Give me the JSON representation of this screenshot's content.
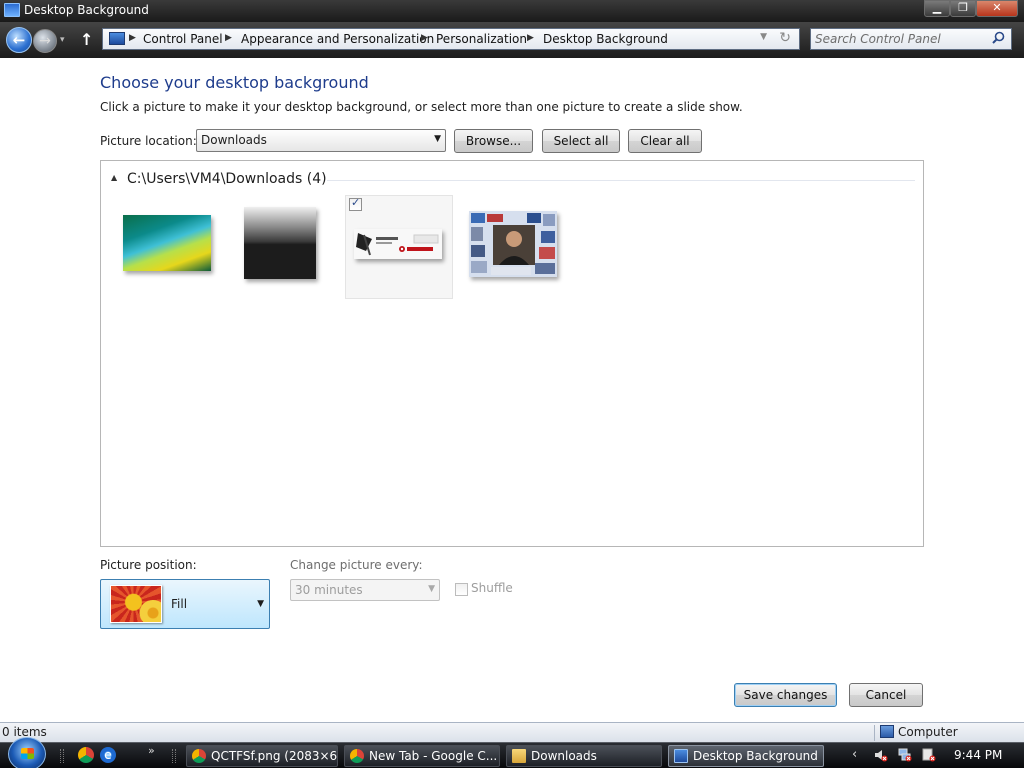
{
  "window": {
    "title": "Desktop Background"
  },
  "window_buttons": {
    "minimize": "▁",
    "maximize": "❐",
    "close": "✕"
  },
  "nav": {
    "back_glyph": "←",
    "forward_glyph": "→",
    "history_glyph": "▾",
    "up_glyph": "↑"
  },
  "breadcrumb": [
    "Control Panel",
    "Appearance and Personalization",
    "Personalization",
    "Desktop Background"
  ],
  "breadcrumb_separator": "▶",
  "search": {
    "placeholder": "Search Control Panel"
  },
  "page": {
    "heading": "Choose your desktop background",
    "instruction": "Click a picture to make it your desktop background, or select more than one picture to create a slide show."
  },
  "picture_location": {
    "label": "Picture location:",
    "value": "Downloads",
    "browse": "Browse...",
    "select_all": "Select all",
    "clear_all": "Clear all"
  },
  "picture_group": {
    "title": "C:\\Users\\VM4\\Downloads (4)",
    "toggle_glyph": "▲",
    "thumbnails": [
      {
        "name": "vista-aurora",
        "selected": false
      },
      {
        "name": "gray-gradient",
        "selected": false
      },
      {
        "name": "target-logo",
        "selected": true
      },
      {
        "name": "photo-collage",
        "selected": false
      }
    ]
  },
  "picture_position": {
    "label": "Picture position:",
    "value": "Fill"
  },
  "change_picture": {
    "label": "Change picture every:",
    "value": "30 minutes",
    "shuffle_label": "Shuffle",
    "enabled": false
  },
  "actions": {
    "save": "Save changes",
    "cancel": "Cancel"
  },
  "status": {
    "items": "0 items",
    "location": "Computer"
  },
  "taskbar": {
    "tasks": [
      {
        "label": "QCTFSf.png (2083×6...",
        "icon": "chrome-icon"
      },
      {
        "label": "New Tab - Google C...",
        "icon": "chrome-icon"
      },
      {
        "label": "Downloads",
        "icon": "folder-icon"
      },
      {
        "label": "Desktop Background",
        "icon": "control-panel-icon",
        "active": true
      }
    ],
    "quick_launch_more": "»",
    "tray_arrow": "‹",
    "clock": "9:44 PM"
  },
  "colors": {
    "heading": "#1e3c8c",
    "selected_position": "#bee6fd",
    "titlebar": "#1a1a1a"
  }
}
